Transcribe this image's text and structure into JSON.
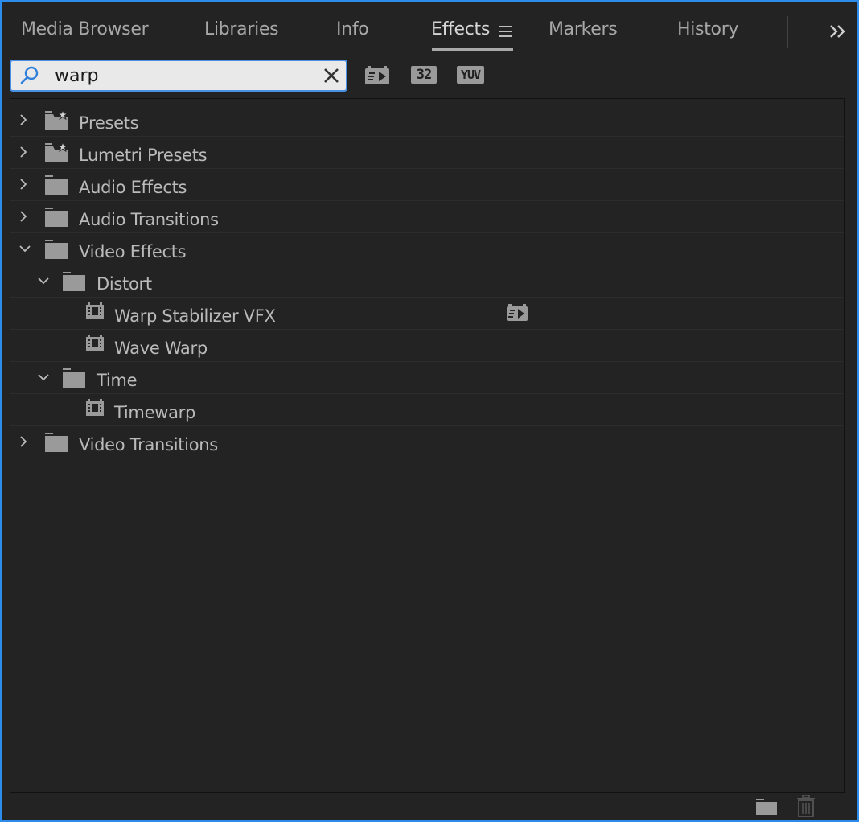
{
  "tabs": [
    {
      "label": "Media Browser",
      "active": false
    },
    {
      "label": "Libraries",
      "active": false
    },
    {
      "label": "Info",
      "active": false
    },
    {
      "label": "Effects",
      "active": true
    },
    {
      "label": "Markers",
      "active": false
    },
    {
      "label": "History",
      "active": false
    }
  ],
  "search": {
    "value": "warp",
    "placeholder": ""
  },
  "filters": [
    {
      "name": "accelerated-effects-filter",
      "icon": "accelerated-effect-icon"
    },
    {
      "name": "32-bit-color-filter",
      "label": "32"
    },
    {
      "name": "yuv-effects-filter",
      "label": "YUV"
    }
  ],
  "tree": [
    {
      "label": "Presets",
      "type": "preset-folder",
      "level": 0,
      "expanded": false
    },
    {
      "label": "Lumetri Presets",
      "type": "preset-folder",
      "level": 0,
      "expanded": false
    },
    {
      "label": "Audio Effects",
      "type": "folder",
      "level": 0,
      "expanded": false
    },
    {
      "label": "Audio Transitions",
      "type": "folder",
      "level": 0,
      "expanded": false
    },
    {
      "label": "Video Effects",
      "type": "folder",
      "level": 0,
      "expanded": true
    },
    {
      "label": "Distort",
      "type": "folder",
      "level": 1,
      "expanded": true
    },
    {
      "label": "Warp Stabilizer VFX",
      "type": "effect",
      "level": 2,
      "accelerated": true
    },
    {
      "label": "Wave Warp",
      "type": "effect",
      "level": 2,
      "accelerated": false
    },
    {
      "label": "Time",
      "type": "folder",
      "level": 1,
      "expanded": true
    },
    {
      "label": "Timewarp",
      "type": "effect",
      "level": 2,
      "accelerated": false
    },
    {
      "label": "Video Transitions",
      "type": "folder",
      "level": 0,
      "expanded": false
    }
  ],
  "colors": {
    "panel": "#232323",
    "focus_border": "#2d8ceb",
    "text": "#bababa",
    "icon": "#9a9a9a"
  },
  "bottom_icons": [
    "new-bin-icon",
    "trash-icon"
  ]
}
